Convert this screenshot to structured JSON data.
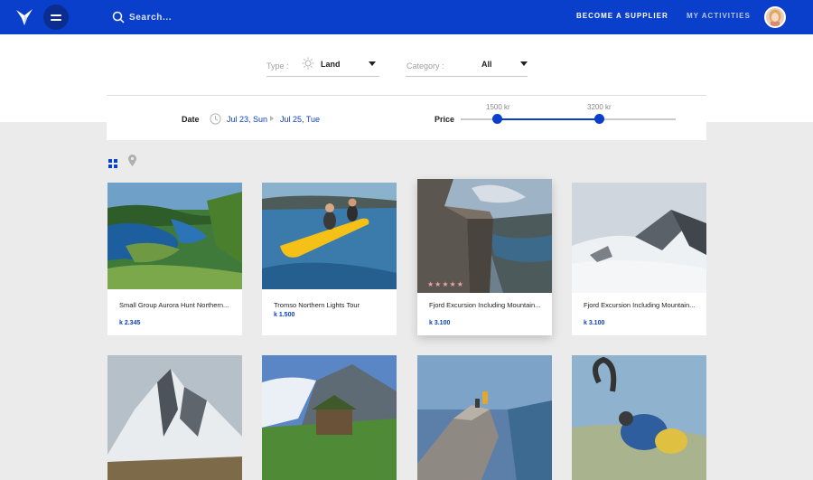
{
  "header": {
    "search_placeholder": "Search...",
    "become_supplier": "BECOME A SUPPLIER",
    "my_activities": "MY ACTIVITIES"
  },
  "filters": {
    "type_label": "Type :",
    "type_value": "Land",
    "category_label": "Category :",
    "category_value": "All",
    "date_label": "Date",
    "date_from": "Jul 23, Sun",
    "date_to": "Jul 25, Tue",
    "price_label": "Price",
    "price_min_label": "1500 kr",
    "price_max_label": "3200 kr"
  },
  "colors": {
    "brand": "#0a3fcc",
    "star": "#f0a2a2"
  },
  "view_icons": [
    "grid-icon",
    "map-pin-icon"
  ],
  "cards": [
    {
      "title": "Small Group Aurora Hunt Northern...",
      "price": "k 2.345"
    },
    {
      "title": "Tromso Northern Lights Tour",
      "price": "k 1.500"
    },
    {
      "title": "Fjord Excursion Including Mountain...",
      "price": "k 3.100",
      "stars": "★★★★★"
    },
    {
      "title": "Fjord Excursion Including Mountain...",
      "price": "k 3.100"
    }
  ]
}
